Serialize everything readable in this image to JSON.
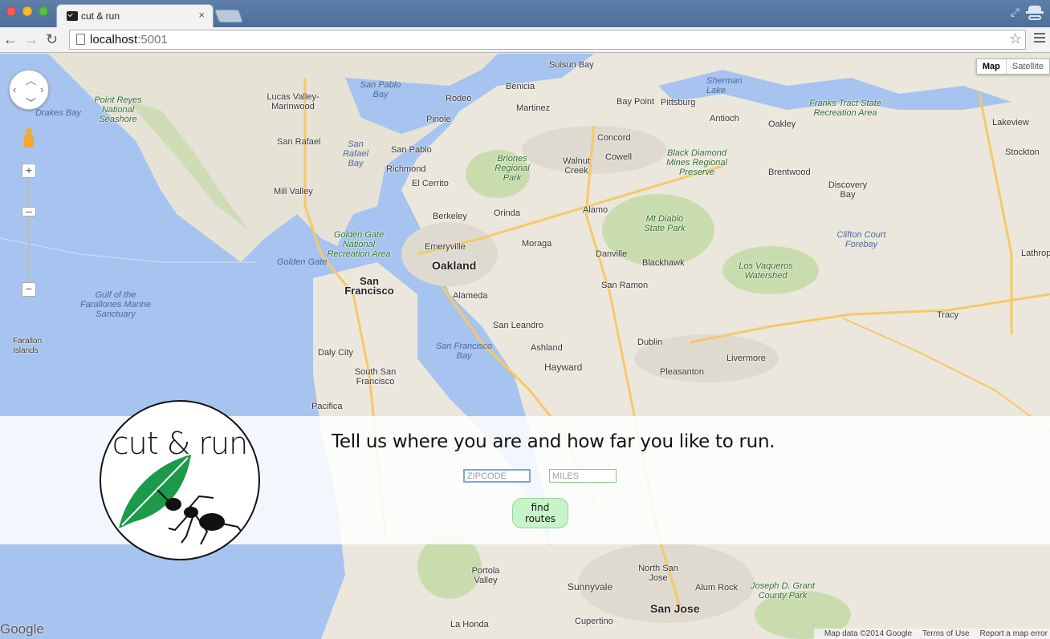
{
  "browser": {
    "tab_title": "cut & run",
    "tab_close": "×",
    "url_host": "localhost",
    "url_port": ":5001",
    "back": "←",
    "forward": "→",
    "reload": "↻",
    "star": "☆",
    "resize": "⤢"
  },
  "map": {
    "map_type_buttons": [
      "Map",
      "Satellite"
    ],
    "zoom_in": "+",
    "zoom_out": "−",
    "google_logo": "Google",
    "attribution": [
      "Map data ©2014 Google",
      "Terms of Use",
      "Report a map error"
    ],
    "labels": {
      "suisun_bay": "Suisun Bay",
      "benicia": "Benicia",
      "sherman_lake": "Sherman Lake",
      "point_reyes": "Point Reyes National Seashore",
      "drakes_bay": "Drakes Bay",
      "lucas_valley": "Lucas Valley-Marinwood",
      "san_pablo_bay": "San Pablo Bay",
      "rodeo": "Rodeo",
      "martinez": "Martinez",
      "bay_point": "Bay Point",
      "pittsburg": "Pittsburg",
      "antioch": "Antioch",
      "oakley": "Oakley",
      "franks_tract": "Franks Tract State Recreation Area",
      "lakeview": "Lakeview",
      "pinole": "Pinole",
      "san_rafael": "San Rafael",
      "san_rafael_bay": "San Rafael Bay",
      "san_pablo": "San Pablo",
      "concord": "Concord",
      "cowell": "Cowell",
      "black_diamond": "Black Diamond Mines Regional Preserve",
      "stockton": "Stockton",
      "richmond": "Richmond",
      "briones": "Briones Regional Park",
      "walnut_creek": "Walnut Creek",
      "brentwood": "Brentwood",
      "discovery_bay": "Discovery Bay",
      "mill_valley": "Mill Valley",
      "el_cerrito": "El Cerrito",
      "berkeley": "Berkeley",
      "orinda": "Orinda",
      "mt_diablo": "Mt Diablo State Park",
      "clifton_court": "Clifton Court Forebay",
      "lathrop": "Lathrop",
      "alamo": "Alamo",
      "golden_gate_nra": "Golden Gate National Recreation Area",
      "emeryville": "Emeryville",
      "moraga": "Moraga",
      "danville": "Danville",
      "blackhawk": "Blackhawk",
      "los_vaqueros": "Los Vaqueros Watershed",
      "golden_gate": "Golden Gate",
      "oakland": "Oakland",
      "san_francisco": "San Francisco",
      "alameda": "Alameda",
      "san_ramon": "San Ramon",
      "gulf_farallones": "Gulf of the Farallones Marine Sanctuary",
      "tracy": "Tracy",
      "san_leandro": "San Leandro",
      "farallon_islands": "Farallon Islands",
      "daly_city": "Daly City",
      "sf_bay": "San Francisco Bay",
      "ashland": "Ashland",
      "dublin": "Dublin",
      "livermore": "Livermore",
      "hayward": "Hayward",
      "pleasanton": "Pleasanton",
      "south_sf": "South San Francisco",
      "pacifica": "Pacifica",
      "portola_valley": "Portola Valley",
      "sunnyvale": "Sunnyvale",
      "north_san_jose": "North San Jose",
      "alum_rock": "Alum Rock",
      "joseph_grant": "Joseph D. Grant County Park",
      "san_jose": "San Jose",
      "cupertino": "Cupertino",
      "la_honda": "La Honda"
    }
  },
  "app": {
    "logo_text": "cut & run",
    "headline": "Tell us where you are and how far you like to run.",
    "zip_placeholder": "ZIPCODE",
    "miles_placeholder": "MILES",
    "find_button": "find routes"
  }
}
